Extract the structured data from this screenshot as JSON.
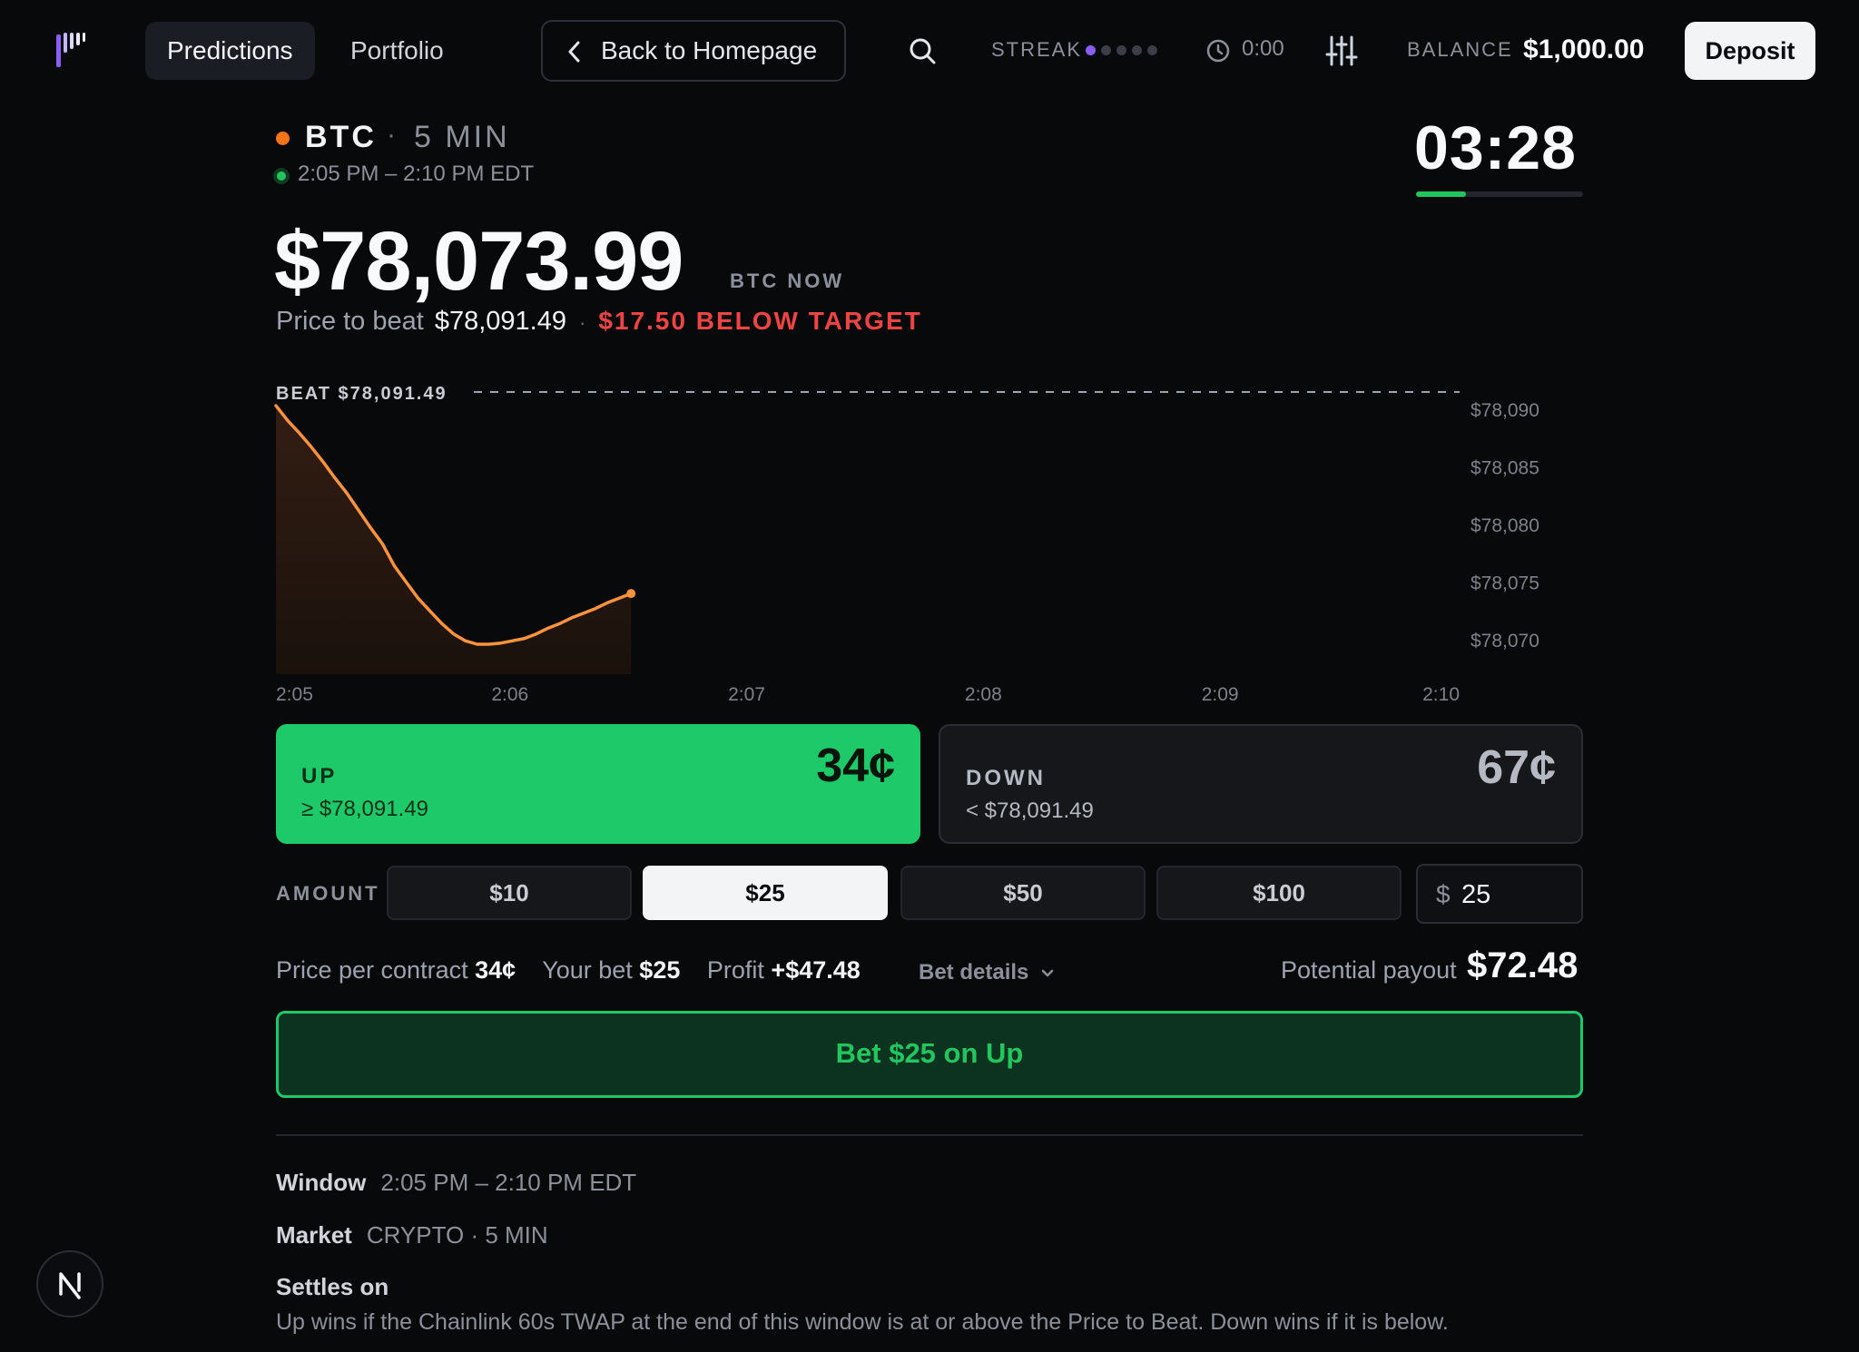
{
  "nav": {
    "tabs": [
      {
        "label": "Predictions",
        "active": true
      },
      {
        "label": "Portfolio",
        "active": false
      }
    ],
    "back_label": "Back to Homepage",
    "streak_label": "STREAK",
    "streak": {
      "filled": 1,
      "total": 5
    },
    "timer": "0:00",
    "balance_label": "BALANCE",
    "balance_value": "$1,000.00",
    "deposit_label": "Deposit"
  },
  "market": {
    "asset": "BTC",
    "separator": "·",
    "interval": "5 MIN",
    "window": "2:05 PM – 2:10 PM EDT",
    "countdown": "03:28",
    "countdown_progress": 0.3,
    "price_now": "$78,073.99",
    "price_now_tag": "BTC NOW",
    "beat_label": "Price to beat",
    "beat_value": "$78,091.49",
    "beat_dot": "·",
    "diff_text": "$17.50 BELOW TARGET"
  },
  "chart_data": {
    "type": "area",
    "beat_label": "BEAT $78,091.49",
    "beat_value": 78091.49,
    "ylim": [
      78067,
      78091.49
    ],
    "y_ticks": [
      {
        "value": 78090,
        "label": "$78,090"
      },
      {
        "value": 78085,
        "label": "$78,085"
      },
      {
        "value": 78080,
        "label": "$78,080"
      },
      {
        "value": 78075,
        "label": "$78,075"
      },
      {
        "value": 78070,
        "label": "$78,070"
      }
    ],
    "x_range_minutes": [
      0,
      5
    ],
    "x_ticks": [
      {
        "value": 0,
        "label": "2:05"
      },
      {
        "value": 0.91,
        "label": "2:06"
      },
      {
        "value": 1.91,
        "label": "2:07"
      },
      {
        "value": 2.91,
        "label": "2:08"
      },
      {
        "value": 3.91,
        "label": "2:09"
      },
      {
        "value": 5,
        "label": "2:10"
      }
    ],
    "series": [
      {
        "x": [
          0,
          0.05,
          0.1,
          0.15,
          0.2,
          0.25,
          0.3,
          0.35,
          0.4,
          0.45,
          0.5,
          0.55,
          0.6,
          0.65,
          0.7,
          0.75,
          0.8,
          0.85,
          0.9,
          0.95,
          1.0,
          1.05,
          1.1,
          1.15,
          1.2,
          1.25,
          1.3,
          1.35,
          1.4,
          1.45,
          1.5
        ],
        "y": [
          78090.3,
          78089.0,
          78087.9,
          78086.7,
          78085.4,
          78084.0,
          78082.7,
          78081.2,
          78079.7,
          78078.3,
          78076.4,
          78075.0,
          78073.6,
          78072.5,
          78071.4,
          78070.5,
          78069.9,
          78069.6,
          78069.6,
          78069.7,
          78069.9,
          78070.1,
          78070.5,
          78071.0,
          78071.4,
          78071.9,
          78072.3,
          78072.7,
          78073.2,
          78073.6,
          78074.0
        ],
        "color": "#fb923c"
      }
    ]
  },
  "outcomes": {
    "up": {
      "name": "UP",
      "cond": "≥ $78,091.49",
      "cents": "34¢"
    },
    "down": {
      "name": "DOWN",
      "cond": "< $78,091.49",
      "cents": "67¢"
    }
  },
  "amount": {
    "label": "AMOUNT",
    "options": [
      "$10",
      "$25",
      "$50",
      "$100"
    ],
    "selected_index": 1,
    "currency": "$",
    "custom_value": "25"
  },
  "summary": {
    "ppc_label": "Price per contract",
    "ppc_value": "34¢",
    "bet_label": "Your bet",
    "bet_value": "$25",
    "profit_label": "Profit",
    "profit_value": "+$47.48",
    "details_label": "Bet details",
    "payout_label": "Potential payout",
    "payout_value": "$72.48"
  },
  "cta_label": "Bet $25 on Up",
  "info": {
    "window_key": "Window",
    "window_val": "2:05 PM – 2:10 PM EDT",
    "market_key": "Market",
    "market_val": "CRYPTO · 5 MIN",
    "settles_key": "Settles on",
    "settles_text": "Up wins if the Chainlink 60s TWAP at the end of this window is at or above the Price to Beat. Down wins if it is below."
  },
  "colors": {
    "accent_green": "#1ec96a",
    "alert_red": "#ef4444",
    "chart_line": "#fb923c",
    "streak_purple": "#8b5cf6"
  }
}
